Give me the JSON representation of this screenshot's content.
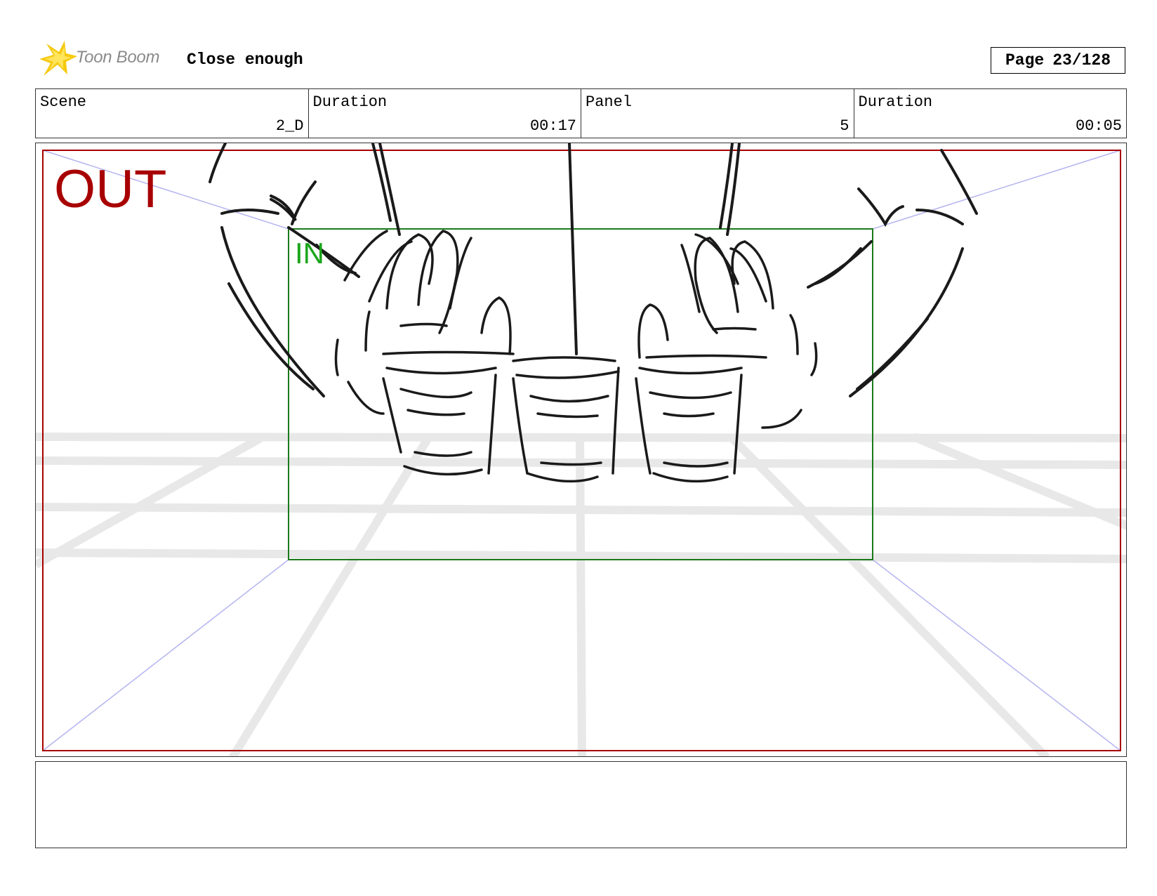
{
  "header": {
    "brand": "Toon Boom",
    "logo_icon": "toon-boom-star-icon",
    "title": "Close enough",
    "page_label": "Page",
    "page_value": "23/128"
  },
  "info": {
    "scene_label": "Scene",
    "scene_value": "2_D",
    "scene_duration_label": "Duration",
    "scene_duration_value": "00:17",
    "panel_label": "Panel",
    "panel_value": "5",
    "panel_duration_label": "Duration",
    "panel_duration_value": "00:05"
  },
  "frame": {
    "out_label": "OUT",
    "in_label": "IN",
    "colors": {
      "out": "#a80000",
      "in": "#1a7a1a",
      "guide": "#b4b4f0",
      "grid": "#e6e6e6"
    },
    "sketch_description_icon": "hands-holding-three-glasses-sketch"
  },
  "notes": {
    "text": ""
  }
}
